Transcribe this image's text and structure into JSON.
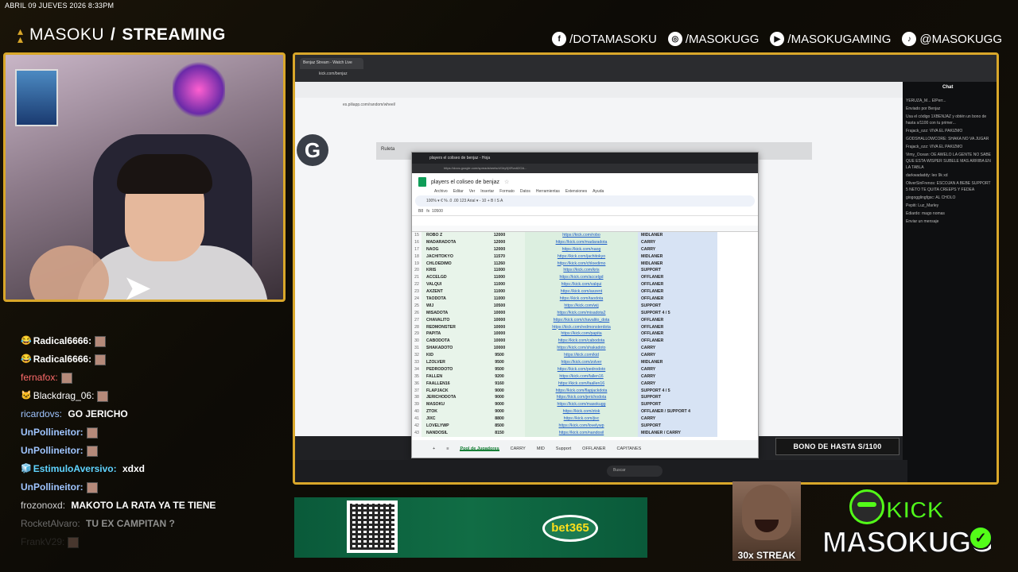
{
  "overlay": {
    "datetime": "ABRIL 09 JUEVES 2026 8:33PM",
    "brand_left": "MASOKU",
    "brand_slash": "/",
    "brand_right": "STREAMING",
    "socials": [
      {
        "icon": "facebook-icon",
        "glyph": "f",
        "label": "/DOTAMASOKU"
      },
      {
        "icon": "instagram-icon",
        "glyph": "◎",
        "label": "/MASOKUGG"
      },
      {
        "icon": "youtube-icon",
        "glyph": "▶",
        "label": "/MASOKUGAMING"
      },
      {
        "icon": "tiktok-icon",
        "glyph": "♪",
        "label": "@MASOKUGG"
      }
    ],
    "accent_color": "#d9a72a"
  },
  "chat": [
    {
      "user": "Radical6666:",
      "color": "#ffffff",
      "badge": "😂",
      "msg": "",
      "emote": true
    },
    {
      "user": "Radical6666:",
      "color": "#ffffff",
      "badge": "😂",
      "msg": "",
      "emote": true
    },
    {
      "user": "fernafox:",
      "color": "#ff6b6b",
      "badge": "",
      "msg": "",
      "emote": true
    },
    {
      "user": "Blackdrag_06:",
      "color": "#ffffff",
      "badge": "🐱",
      "msg": "",
      "emote": true
    },
    {
      "user": "ricardovs:",
      "color": "#9fc5ff",
      "badge": "",
      "msg": "GO JERICHO",
      "emote": false
    },
    {
      "user": "UnPollineitor:",
      "color": "#9fc5ff",
      "badge": "",
      "msg": "",
      "emote": true
    },
    {
      "user": "UnPollineitor:",
      "color": "#9fc5ff",
      "badge": "",
      "msg": "",
      "emote": true
    },
    {
      "user": "EstimuloAversivo:",
      "color": "#5fd4ff",
      "badge": "🧊",
      "msg": "xdxd",
      "emote": false
    },
    {
      "user": "UnPollineitor:",
      "color": "#9fc5ff",
      "badge": "",
      "msg": "",
      "emote": true
    },
    {
      "user": "frozonoxd:",
      "color": "#d0d0d0",
      "badge": "",
      "msg": "MAKOTO LA RATA YA TE TIENE",
      "emote": false
    },
    {
      "user": "RocketAlvaro:",
      "color": "#8a8a8a",
      "badge": "",
      "msg": "TU EX CAMPITAN ?",
      "emote": false
    },
    {
      "user": "FrankV29:",
      "color": "#5a5a5a",
      "badge": "",
      "msg": "",
      "emote": true
    }
  ],
  "screen": {
    "browser_tab": "Benjaz Stream - Watch Live",
    "browser_url": "kick.com/benjaz",
    "inner_url": "es.piliapp.com/random/wheel/",
    "ruleta_label": "Ruleta",
    "chat_title": "Chat",
    "chat_lines": [
      "YERUZA_M... ElPerr...",
      "Enviado por Benjaz",
      "Usa el código 1XBENJAZ y obtén un bono de hasta s/1100 con tu primer...",
      "Frajack_ozz: VIVA EL PAKIZMO",
      "GODSHALLOWCORE: SHAKA NO VA JUGAR",
      "Frajack_ozz: VIVA EL PAKIZMO",
      "Vimy_Ocean: OE AWELO LA GENTE NO SABE QUE ESTA WISPER SUBELE MAS ARRIBA EN LA TABLA",
      "darkwadaddy: leo 9k xd",
      "OliverSinFrenos: ESCOJAN A BEBE SUPPORT 5 NETO TE QUITA CREEPS Y FEDEA",
      "giogogglingfgsc: AL CHOLO",
      "Pepiti: Luz_Marley",
      "Ediardo: mago nomas",
      "Enviar un mensaje"
    ],
    "taskbar_search": "Buscar",
    "bono_text": "BONO DE HASTA S/1100"
  },
  "sheets": {
    "tab_title": "players el coliseo de benjaz - Hoja",
    "url": "https://docs.google.com/spreadsheets/d/1hy9jXRzc62OA...",
    "doc_title": "players el coliseo de benjaz",
    "menu": [
      "Archivo",
      "Editar",
      "Ver",
      "Insertar",
      "Formato",
      "Datos",
      "Herramientas",
      "Extensiones",
      "Ayuda"
    ],
    "toolbar": "100%  ▾  €  %  .0  .00  123  Arial  ▾  -  10  +  B  I  S  A",
    "cell_ref": "B8",
    "formula": "10500",
    "rows": [
      {
        "n": "15",
        "name": "ROBO Z",
        "mmr": "12000",
        "link": "https://kick.com/robo",
        "role": "MIDLANER"
      },
      {
        "n": "16",
        "name": "MADARADOTA",
        "mmr": "12000",
        "link": "https://kick.com/madaradota",
        "role": "CARRY"
      },
      {
        "n": "17",
        "name": "NAOG",
        "mmr": "12000",
        "link": "https://kick.com/naog",
        "role": "CARRY"
      },
      {
        "n": "18",
        "name": "JACHITOKYO",
        "mmr": "11570",
        "link": "https://kick.com/jachitokyo",
        "role": "MIDLANER"
      },
      {
        "n": "19",
        "name": "CHLOEDIMO",
        "mmr": "11260",
        "link": "https://kick.com/chloedimo",
        "role": "MIDLANER"
      },
      {
        "n": "20",
        "name": "KRIS",
        "mmr": "11000",
        "link": "https://kick.com/kris",
        "role": "SUPPORT"
      },
      {
        "n": "21",
        "name": "ACCELGD",
        "mmr": "11000",
        "link": "https://kick.com/accelgd",
        "role": "OFFLANER"
      },
      {
        "n": "22",
        "name": "VALQUI",
        "mmr": "11000",
        "link": "https://kick.com/valqui",
        "role": "OFFLANER"
      },
      {
        "n": "23",
        "name": "AXZENT",
        "mmr": "11000",
        "link": "https://kick.com/axzent",
        "role": "OFFLANER"
      },
      {
        "n": "24",
        "name": "TAODOTA",
        "mmr": "11000",
        "link": "https://kick.com/taodota",
        "role": "OFFLANER"
      },
      {
        "n": "25",
        "name": "WIJ",
        "mmr": "10500",
        "link": "https://kick.com/wij",
        "role": "SUPPORT"
      },
      {
        "n": "26",
        "name": "MISADOTA",
        "mmr": "10000",
        "link": "https://kick.com/misadota2",
        "role": "SUPPORT 4 / 5"
      },
      {
        "n": "27",
        "name": "CHAVALITO",
        "mmr": "10000",
        "link": "https://kick.com/chavalito_dota",
        "role": "OFFLANER"
      },
      {
        "n": "28",
        "name": "REDMONSTER",
        "mmr": "10000",
        "link": "https://kick.com/redmonsterdota",
        "role": "OFFLANER"
      },
      {
        "n": "29",
        "name": "PAPITA",
        "mmr": "10000",
        "link": "https://kick.com/papita",
        "role": "OFFLANER"
      },
      {
        "n": "30",
        "name": "CABODOTA",
        "mmr": "10000",
        "link": "https://kick.com/cabodota",
        "role": "OFFLANER"
      },
      {
        "n": "31",
        "name": "SHAKADOTO",
        "mmr": "10000",
        "link": "https://kick.com/shakadoto",
        "role": "CARRY"
      },
      {
        "n": "32",
        "name": "KID",
        "mmr": "9500",
        "link": "https://kick.com/kid",
        "role": "CARRY"
      },
      {
        "n": "33",
        "name": "LZOLVER",
        "mmr": "9500",
        "link": "https://kick.com/zolver",
        "role": "MIDLANER"
      },
      {
        "n": "34",
        "name": "PEDRODOTO",
        "mmr": "9500",
        "link": "https://kick.com/pedrodoto",
        "role": "CARRY"
      },
      {
        "n": "35",
        "name": "FALLEN",
        "mmr": "9200",
        "link": "https://kick.com/fallen16",
        "role": "CARRY"
      },
      {
        "n": "36",
        "name": "FAALLEN16",
        "mmr": "9160",
        "link": "https://kick.com/faallen16",
        "role": "CARRY"
      },
      {
        "n": "37",
        "name": "FLAPJACK",
        "mmr": "9000",
        "link": "https://kick.com/flapjackdota",
        "role": "SUPPORT 4 / 5"
      },
      {
        "n": "38",
        "name": "JERICHODOTA",
        "mmr": "9000",
        "link": "https://kick.com/jerichodota",
        "role": "SUPPORT"
      },
      {
        "n": "39",
        "name": "MASOKU",
        "mmr": "9000",
        "link": "https://kick.com/masokugg",
        "role": "SUPPORT"
      },
      {
        "n": "40",
        "name": "ZTOK",
        "mmr": "9000",
        "link": "https://kick.com/ztok",
        "role": "OFFLANER / SUPPORT 4"
      },
      {
        "n": "41",
        "name": "JIXC",
        "mmr": "8800",
        "link": "https://kick.com/jixc",
        "role": "CARRY"
      },
      {
        "n": "42",
        "name": "LOVELYWP",
        "mmr": "8500",
        "link": "https://kick.com/lovelywp",
        "role": "SUPPORT"
      },
      {
        "n": "43",
        "name": "NANDOSIL",
        "mmr": "8150",
        "link": "https://kick.com/nandosil",
        "role": "MIDLANER / CARRY"
      }
    ],
    "sheet_tabs": [
      "+",
      "≡",
      "Pool de Jugadores",
      "CARRY",
      "MID",
      "Support",
      "OFFLANER",
      "CAPITANES"
    ]
  },
  "bottom": {
    "bet_logo": "bet365",
    "streak": "30x STREAK",
    "kick_word": "KICK",
    "kick_user": "MASOKUGG",
    "kick_green": "#53fc18"
  }
}
